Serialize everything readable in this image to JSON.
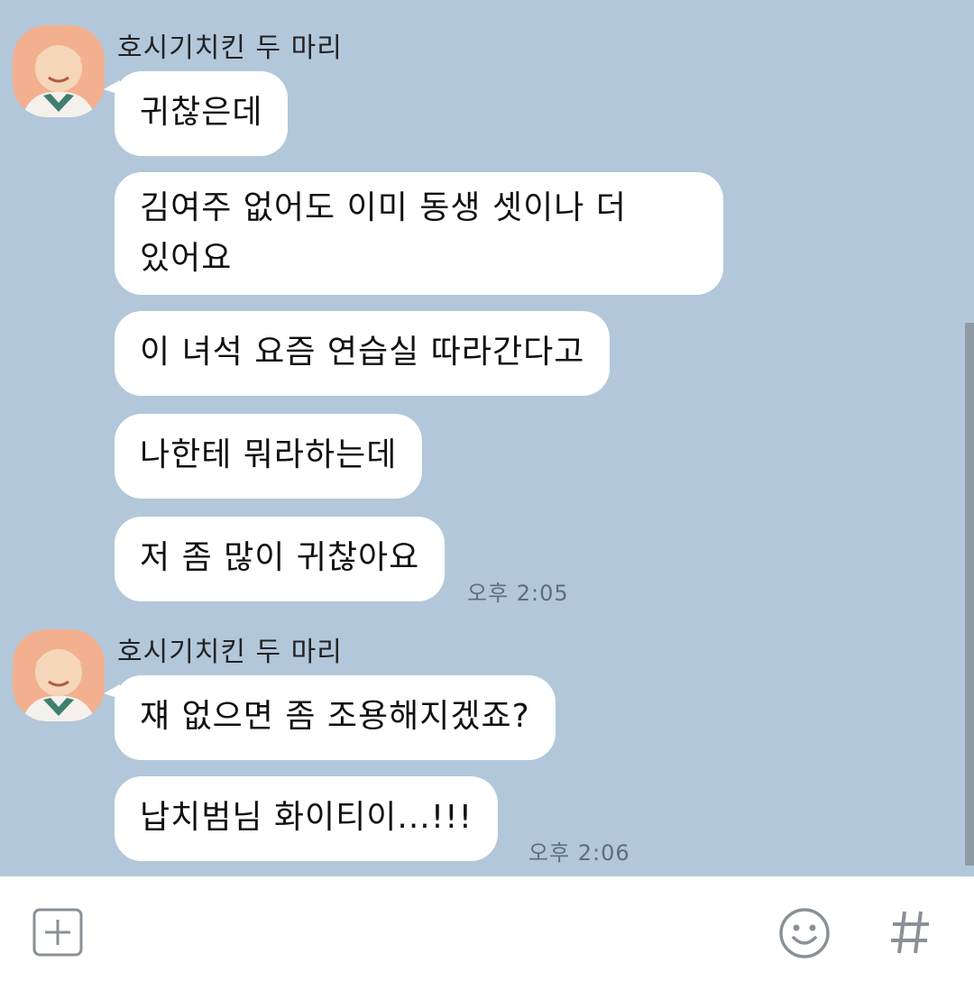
{
  "messages_group_1": {
    "sender": "호시기치킨 두 마리",
    "bubbles": [
      "귀찮은데",
      "김여주 없어도 이미 동생 셋이나 더",
      "있어요",
      "이 녀석 요즘 연습실 따라간다고",
      "나한테 뭐라하는데",
      "저 좀 많이 귀찮아요"
    ],
    "time": "오후 2:05"
  },
  "messages_group_2": {
    "sender": "호시기치킨 두 마리",
    "bubbles": [
      "쟤 없으면 좀 조용해지겠죠?",
      "납치범님 화이티이...!!!"
    ],
    "time": "오후 2:06"
  },
  "input_bar": {
    "add_icon": "plus-square-icon",
    "emoji_icon": "smiley-icon",
    "hash_icon": "hash-icon"
  },
  "colors": {
    "chat_background": "#b2c7da",
    "bubble": "#ffffff",
    "input_background": "#ffffff",
    "icon": "#8a9097"
  }
}
